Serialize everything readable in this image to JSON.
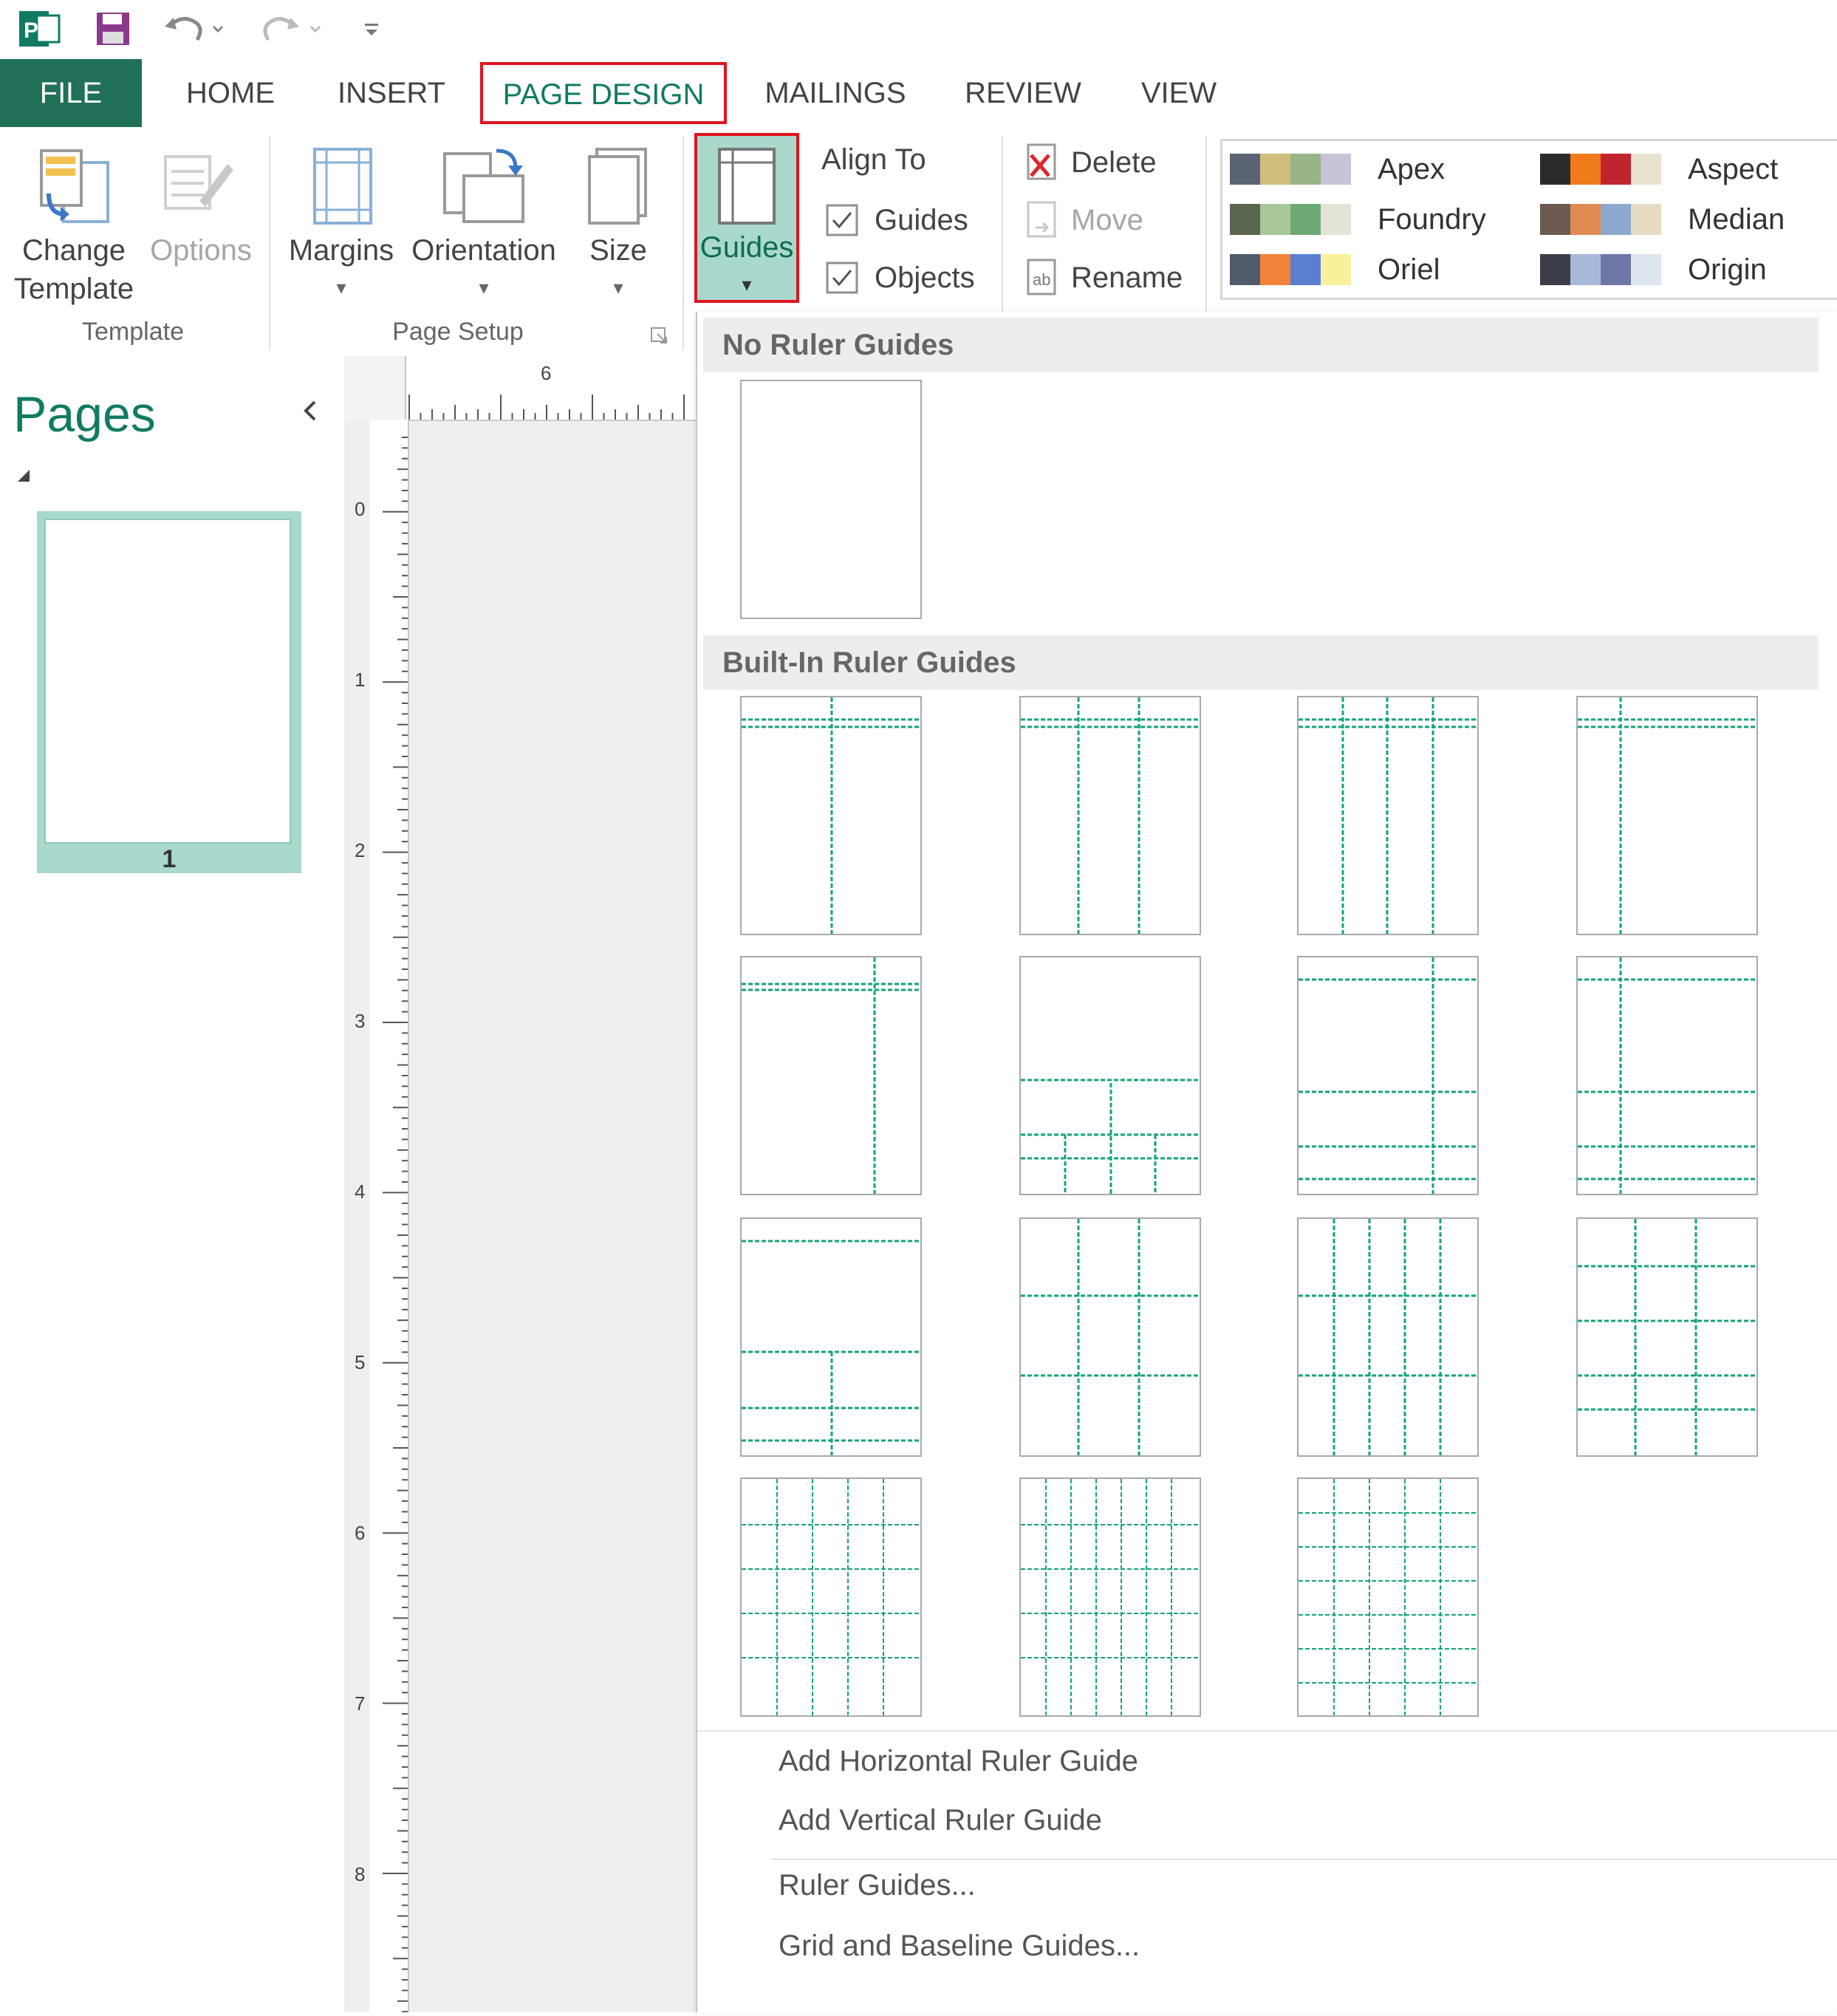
{
  "quick_access": {
    "app_icon": "publisher-icon",
    "save_icon": "save-icon",
    "undo_icon": "undo-icon",
    "redo_icon": "redo-icon",
    "customize_icon": "customize-qat-icon"
  },
  "tabs": [
    {
      "label": "FILE"
    },
    {
      "label": "HOME"
    },
    {
      "label": "INSERT"
    },
    {
      "label": "PAGE DESIGN"
    },
    {
      "label": "MAILINGS"
    },
    {
      "label": "REVIEW"
    },
    {
      "label": "VIEW"
    }
  ],
  "ribbon": {
    "template_group": {
      "change_template_line1": "Change",
      "change_template_line2": "Template",
      "options": "Options",
      "label": "Template"
    },
    "page_setup_group": {
      "margins": "Margins",
      "orientation": "Orientation",
      "size": "Size",
      "label": "Page Setup"
    },
    "guides": "Guides",
    "align_to": {
      "title": "Align To",
      "guides": "Guides",
      "objects": "Objects",
      "guides_checked": true,
      "objects_checked": true
    },
    "page_actions": {
      "delete": "Delete",
      "move": "Move",
      "rename": "Rename"
    },
    "schemes": [
      {
        "name": "Apex",
        "colors": [
          "#5a6474",
          "#cfbf7a",
          "#9ab48a",
          "#c8c4d8"
        ]
      },
      {
        "name": "Aspect",
        "colors": [
          "#2b2b2b",
          "#f07b1d",
          "#c0242f",
          "#e8e2d0"
        ]
      },
      {
        "name": "Foundry",
        "colors": [
          "#5a6650",
          "#a9c89a",
          "#6ea874",
          "#e4e3d7"
        ]
      },
      {
        "name": "Median",
        "colors": [
          "#6d5a50",
          "#e08a54",
          "#8fa8cf",
          "#e6dbc3"
        ]
      },
      {
        "name": "Oriel",
        "colors": [
          "#4f5a6b",
          "#f1833a",
          "#5a7fd1",
          "#f9f09c"
        ]
      },
      {
        "name": "Origin",
        "colors": [
          "#3b3d48",
          "#a8b8d8",
          "#6e76a8",
          "#dde5ef"
        ]
      }
    ]
  },
  "pages_pane": {
    "title": "Pages",
    "collapse_icon": "chevron-left-icon",
    "page_number": "1"
  },
  "rulers": {
    "h_label": "6",
    "v_labels": [
      "0",
      "1",
      "2",
      "3",
      "4",
      "5",
      "6",
      "7",
      "8"
    ]
  },
  "gallery": {
    "no_guides_heading": "No Ruler Guides",
    "builtin_heading": "Built-In Ruler Guides",
    "menu": {
      "add_horizontal": "Add Horizontal Ruler Guide",
      "add_vertical": "Add Vertical Ruler Guide",
      "ruler_guides": "Ruler Guides...",
      "grid_baseline": "Grid and Baseline Guides..."
    }
  },
  "colors": {
    "accent": "#0f7b62",
    "guide": "#14a37a",
    "highlight_border": "#e0141e",
    "selected_fill": "#a9d9cc"
  }
}
